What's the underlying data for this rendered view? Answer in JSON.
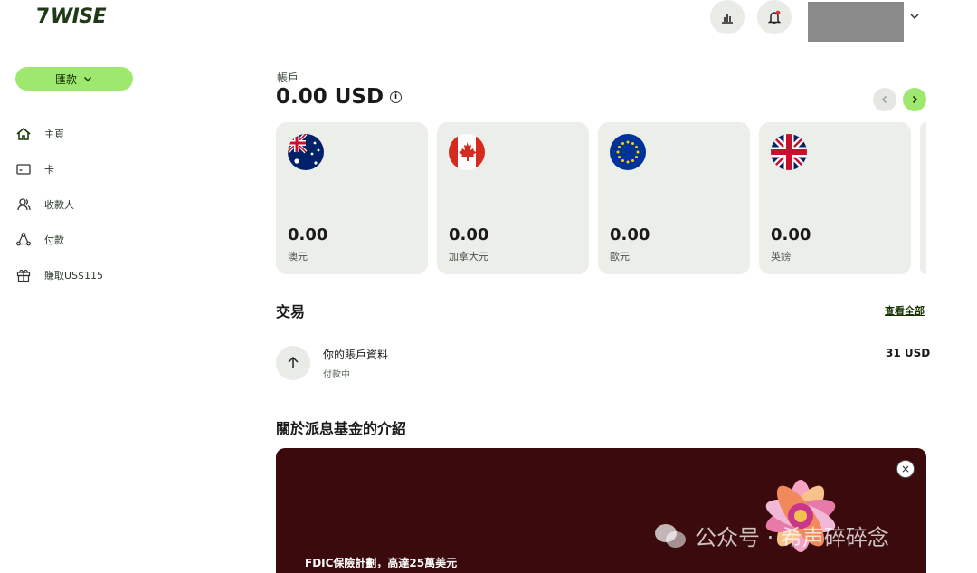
{
  "header": {
    "logo": "WISE",
    "logo_flag": "7"
  },
  "sidebar": {
    "send_label": "匯款",
    "items": [
      {
        "label": "主頁",
        "icon": "home-icon"
      },
      {
        "label": "卡",
        "icon": "card-icon"
      },
      {
        "label": "收款人",
        "icon": "recipients-icon"
      },
      {
        "label": "付款",
        "icon": "payments-icon"
      },
      {
        "label": "賺取US$115",
        "icon": "gift-icon"
      }
    ]
  },
  "account": {
    "label": "帳戶",
    "balance": "0.00 USD",
    "info": "i"
  },
  "cards": [
    {
      "amount": "0.00",
      "currency": "澳元",
      "flag": "australia-flag-icon"
    },
    {
      "amount": "0.00",
      "currency": "加拿大元",
      "flag": "canada-flag-icon"
    },
    {
      "amount": "0.00",
      "currency": "歐元",
      "flag": "eu-flag-icon"
    },
    {
      "amount": "0.00",
      "currency": "英鎊",
      "flag": "uk-flag-icon"
    }
  ],
  "transactions": {
    "title": "交易",
    "see_all": "查看全部",
    "items": [
      {
        "name": "你的賬戶資料",
        "status": "付款中",
        "amount": "31 USD"
      }
    ]
  },
  "about": {
    "title": "關於派息基金的介紹",
    "banner_text": "FDIC保險計劃，高達25萬美元",
    "close": "×"
  },
  "watermark": {
    "text": "公众号 · 希声碎碎念"
  },
  "colors": {
    "accent": "#9fe870",
    "brand_dark": "#163300",
    "card_bg": "#eceeea",
    "banner_bg": "#3a0a0c"
  }
}
